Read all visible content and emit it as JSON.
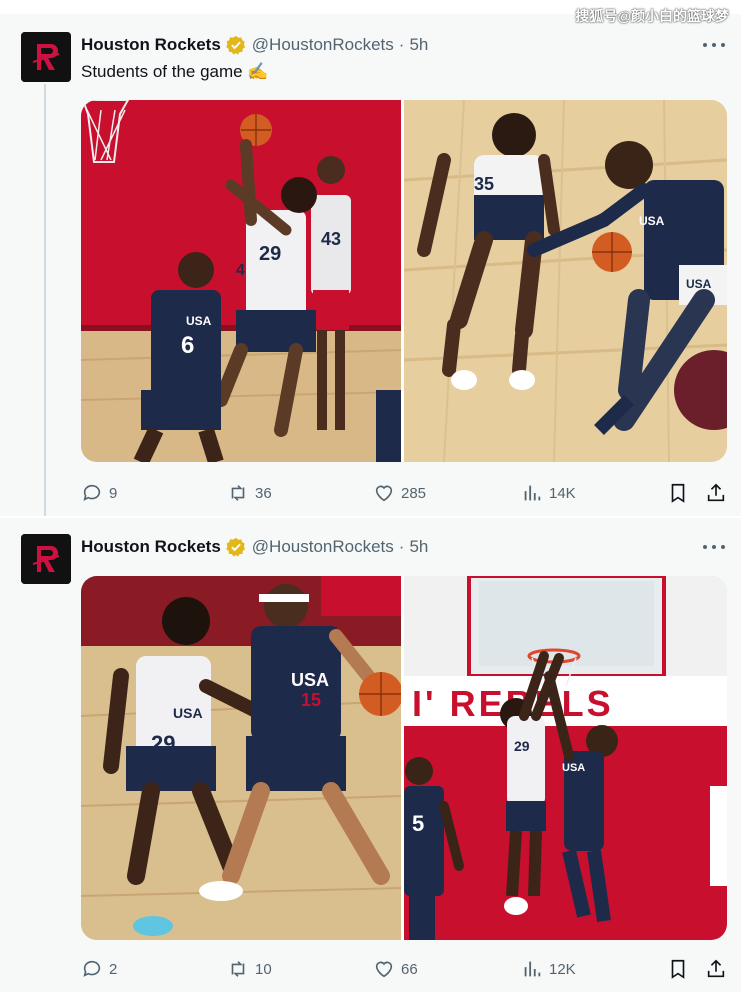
{
  "watermark": "搜狐号@颜小白的篮球梦",
  "tweets": [
    {
      "name": "Houston Rockets",
      "handle": "@HoustonRockets",
      "separator": "·",
      "time": "5h",
      "text": "Students of the game ✍️",
      "stats": {
        "replies": "9",
        "retweets": "36",
        "likes": "285",
        "views": "14K"
      }
    },
    {
      "name": "Houston Rockets",
      "handle": "@HoustonRockets",
      "separator": "·",
      "time": "5h",
      "text": "",
      "stats": {
        "replies": "2",
        "retweets": "10",
        "likes": "66",
        "views": "12K"
      }
    }
  ],
  "photos": {
    "p1": {
      "jersey_main": "USA",
      "num_a": "6",
      "num_b": "29",
      "num_c": "43",
      "num_d": "4"
    },
    "p2": {
      "jersey_a": "USA",
      "num_a": "35",
      "jersey_b": "USA"
    },
    "p3": {
      "jersey_a": "USA",
      "num_a": "29",
      "jersey_b": "USA",
      "num_b": "15"
    },
    "p4": {
      "wall_text": "I' REBELS",
      "num_a": "5",
      "num_b": "29",
      "jersey_b": "USA"
    }
  },
  "colors": {
    "brand_red": "#ce1141",
    "verified_gold": "#e2b719",
    "court_wood": "#d9b887",
    "wall_red": "#c8102e",
    "navy": "#1e2a4a"
  }
}
